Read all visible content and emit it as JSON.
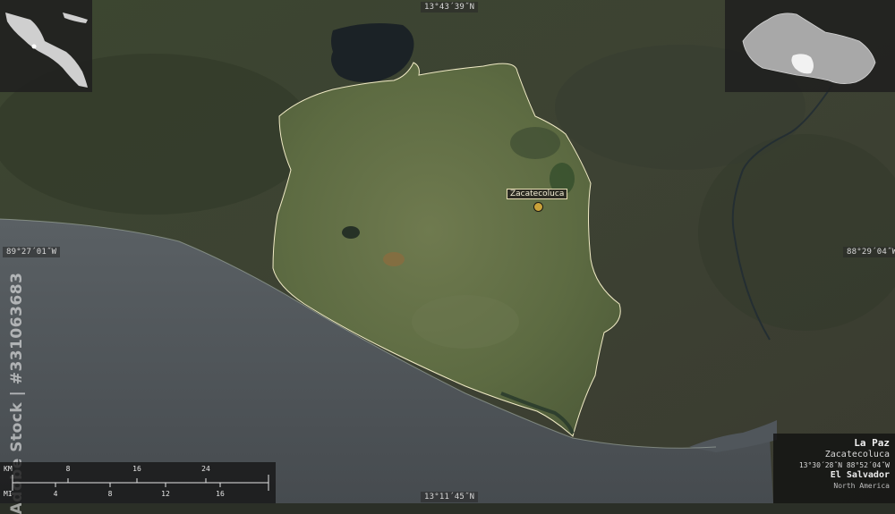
{
  "coordinates": {
    "top": "13°43´39˝N",
    "bottom": "13°11´45˝N",
    "left": "89°27´01˝W",
    "right": "88°29´04˝W"
  },
  "city": {
    "name": "Zacatecoluca"
  },
  "watermark": {
    "stock_id": "Adobe Stock | #331063683"
  },
  "scale": {
    "km_unit": "KM",
    "km_ticks": [
      "8",
      "16",
      "24"
    ],
    "mi_unit": "MI",
    "mi_ticks": [
      "4",
      "8",
      "12",
      "16"
    ]
  },
  "info": {
    "region": "La Paz",
    "capital": "Zacatecoluca",
    "capital_coords": "13°30´28˝N 88°52´04˝W",
    "country": "El Salvador",
    "continent": "North America"
  },
  "colors": {
    "region_border": "#f1ebc6",
    "city_marker": "#c9a23a",
    "ocean": "#4f5458",
    "land": "#3a4232"
  },
  "icons": [
    "central-america-locator-icon",
    "el-salvador-locator-icon",
    "city-marker-icon"
  ]
}
